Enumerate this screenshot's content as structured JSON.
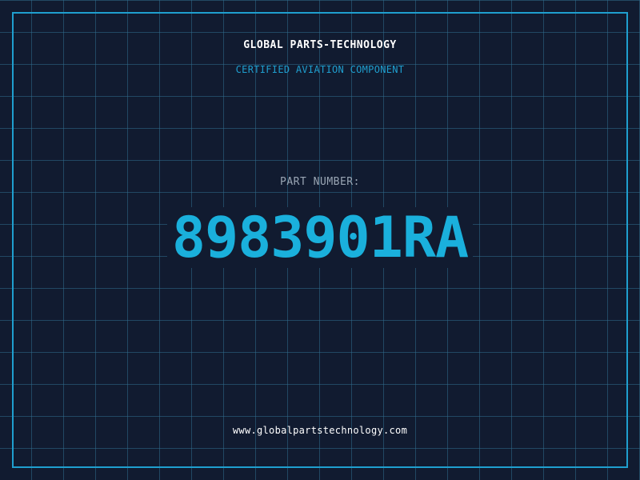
{
  "header": {
    "company_name": "GLOBAL PARTS-TECHNOLOGY",
    "subtitle": "CERTIFIED AVIATION COMPONENT"
  },
  "part": {
    "label": "PART NUMBER:",
    "number": "8983901RA"
  },
  "footer": {
    "website": "www.globalpartstechnology.com"
  },
  "colors": {
    "background": "#111b30",
    "grid": "#2f6e8c",
    "accent": "#1f9fcf",
    "part_number": "#1ab0dc",
    "label": "#9aa6b4",
    "text": "#ffffff"
  }
}
